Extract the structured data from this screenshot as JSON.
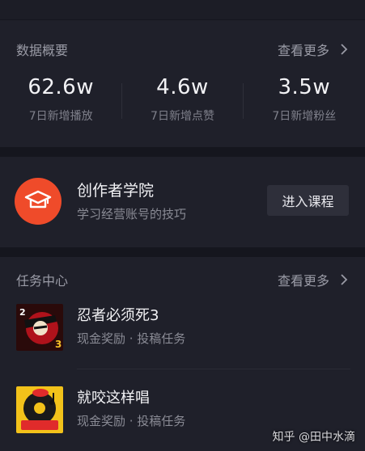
{
  "stats": {
    "title": "数据概要",
    "more": "查看更多",
    "items": [
      {
        "value": "62.6w",
        "label": "7日新增播放"
      },
      {
        "value": "4.6w",
        "label": "7日新增点赞"
      },
      {
        "value": "3.5w",
        "label": "7日新增粉丝"
      }
    ]
  },
  "academy": {
    "title": "创作者学院",
    "subtitle": "学习经营账号的技巧",
    "button": "进入课程",
    "icon": "graduation-cap-icon",
    "accent": "#ef4b2a"
  },
  "tasks": {
    "title": "任务中心",
    "more": "查看更多",
    "items": [
      {
        "name": "忍者必须死3",
        "meta": "现金奖励 · 投稿任务"
      },
      {
        "name": "就咬这样唱",
        "meta": "现金奖励 · 投稿任务"
      }
    ]
  },
  "watermark": "知乎 @田中水滴"
}
